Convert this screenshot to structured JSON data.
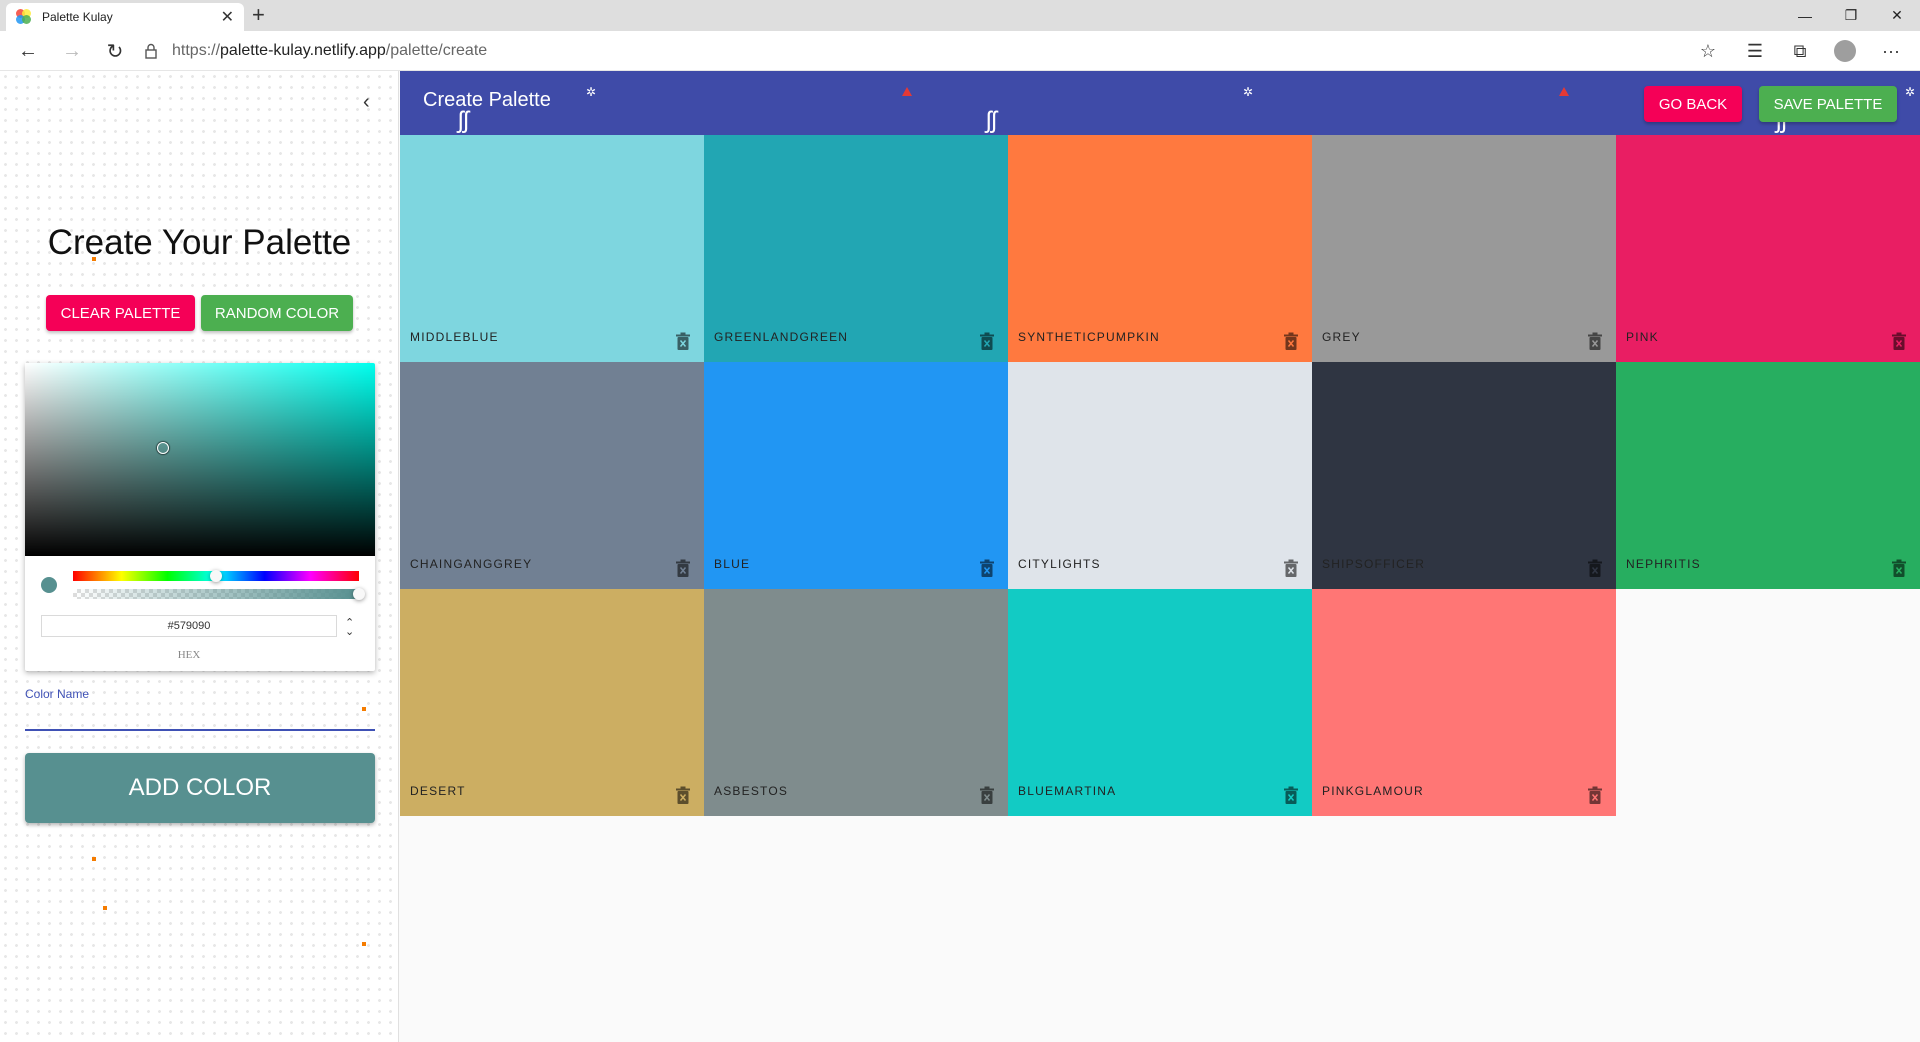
{
  "browser": {
    "tab_title": "Palette Kulay",
    "url_prefix": "https://",
    "url_host": "palette-kulay.netlify.app",
    "url_path": "/palette/create"
  },
  "sidebar": {
    "title": "Create Your Palette",
    "clear_label": "CLEAR PALETTE",
    "random_label": "RANDOM COLOR",
    "picker": {
      "hex_value": "#579090",
      "hex_label": "HEX",
      "hue_level": 0.5,
      "alpha_level": 1.0
    },
    "color_name_label": "Color Name",
    "color_name_value": "",
    "add_label": "ADD COLOR"
  },
  "appbar": {
    "title": "Create Palette",
    "go_back_label": "GO BACK",
    "save_label": "SAVE PALETTE"
  },
  "colors": {
    "primary": "#3f4ba8",
    "accent_pink": "#f50057",
    "accent_green": "#4caf50",
    "add_button": "#579090",
    "picker_hue": "#00ffee"
  },
  "palette": [
    {
      "name": "MIDDLEBLUE",
      "color": "#7ed6df",
      "text": "#222"
    },
    {
      "name": "GREENLANDGREEN",
      "color": "#22a6b3",
      "text": "#222"
    },
    {
      "name": "SYNTHETICPUMPKIN",
      "color": "#ff793f",
      "text": "#222"
    },
    {
      "name": "GREY",
      "color": "#999999",
      "text": "#222"
    },
    {
      "name": "PINK",
      "color": "#e91e63",
      "text": "#222"
    },
    {
      "name": "CHAINGANGGREY",
      "color": "#718093",
      "text": "#222"
    },
    {
      "name": "BLUE",
      "color": "#2196f3",
      "text": "#222"
    },
    {
      "name": "CITYLIGHTS",
      "color": "#dfe4ea",
      "text": "#222"
    },
    {
      "name": "SHIPSOFFICER",
      "color": "#2f3542",
      "text": "#222"
    },
    {
      "name": "NEPHRITIS",
      "color": "#27ae60",
      "text": "#222"
    },
    {
      "name": "DESERT",
      "color": "#ccae62",
      "text": "#222"
    },
    {
      "name": "ASBESTOS",
      "color": "#7f8c8d",
      "text": "#222"
    },
    {
      "name": "BLUEMARTINA",
      "color": "#12cbc4",
      "text": "#222"
    },
    {
      "name": "PINKGLAMOUR",
      "color": "#ff7675",
      "text": "#222"
    }
  ]
}
